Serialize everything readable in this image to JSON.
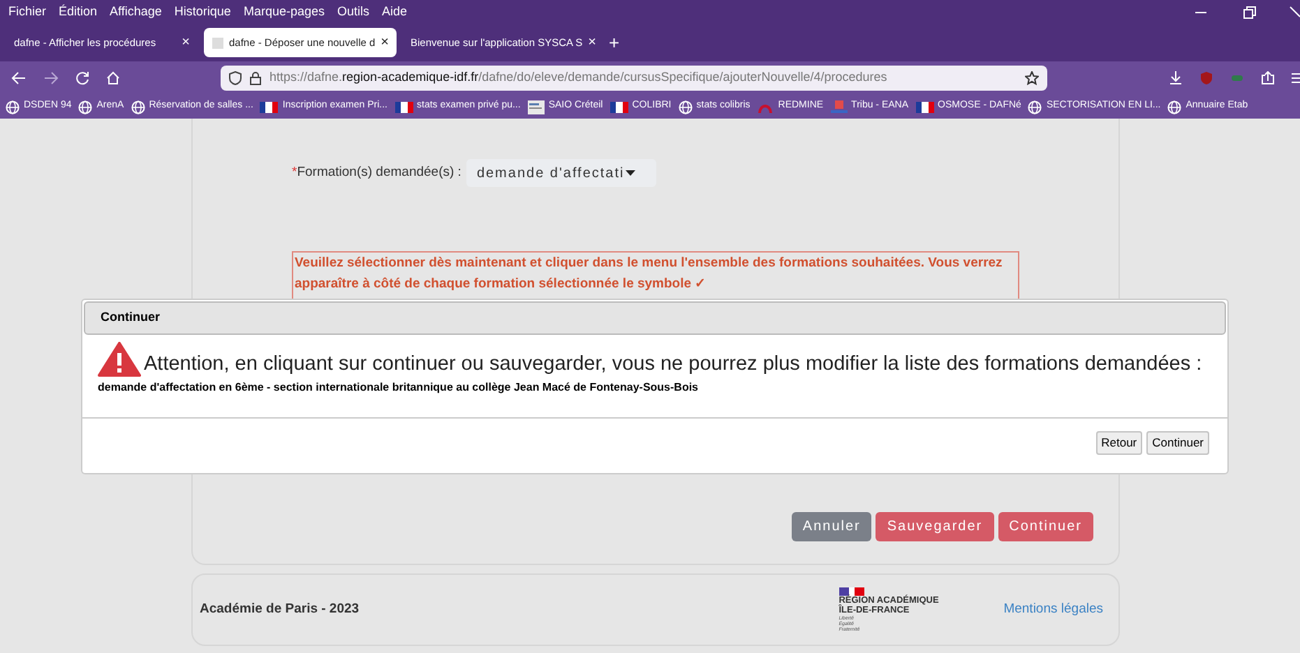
{
  "menu_bar": [
    "Fichier",
    "Édition",
    "Affichage",
    "Historique",
    "Marque-pages",
    "Outils",
    "Aide"
  ],
  "tabs": [
    {
      "label": "dafne - Afficher les procédures",
      "close": "×",
      "selected": false
    },
    {
      "label": "dafne - Déposer une nouvelle d",
      "close": "×",
      "selected": true
    },
    {
      "label": "Bienvenue sur l'application SYSCA S",
      "close": "×",
      "selected": false
    }
  ],
  "new_tab": "+",
  "address_bar": {
    "url_prefix": "https://dafne.",
    "url_domain": "region-academique-idf.fr",
    "url_path": "/dafne/do/eleve/demande/cursusSpecifique/ajouterNouvelle/4/procedures"
  },
  "bookmarks": [
    {
      "label": "DSDEN 94",
      "kind": "globe"
    },
    {
      "label": "ArenA",
      "kind": "globe"
    },
    {
      "label": "Réservation de salles ...",
      "kind": "globe"
    },
    {
      "label": "Inscription examen Pri...",
      "kind": "flag"
    },
    {
      "label": "stats examen privé pu...",
      "kind": "flag"
    },
    {
      "label": "SAIO Créteil",
      "kind": "doc"
    },
    {
      "label": "COLIBRI",
      "kind": "flag"
    },
    {
      "label": "stats colibris",
      "kind": "globe"
    },
    {
      "label": "REDMINE",
      "kind": "arch"
    },
    {
      "label": "Tribu - EANA",
      "kind": "tribu"
    },
    {
      "label": "OSMOSE - DAFNé",
      "kind": "flag"
    },
    {
      "label": "SECTORISATION EN LI...",
      "kind": "globe"
    },
    {
      "label": "Annuaire Etab",
      "kind": "globe"
    }
  ],
  "form": {
    "required_mark": "*",
    "label": "Formation(s) demandée(s) :",
    "select_value": "demande d'affectati",
    "notice": "Veuillez sélectionner dès maintenant et cliquer dans le menu l'ensemble des formations souhaitées. Vous verrez apparaître à côté de chaque formation sélectionnée le symbole ✓",
    "buttons": [
      {
        "label": "Annuler",
        "kind": "secondary"
      },
      {
        "label": "Sauvegarder",
        "kind": "danger"
      },
      {
        "label": "Continuer",
        "kind": "danger"
      }
    ]
  },
  "dialog": {
    "title": "Continuer",
    "warning": "Attention, en cliquant sur continuer ou sauvegarder, vous ne pourrez plus modifier la liste des formations demandées :",
    "detail": "demande d'affectation en 6ème - section internationale britannique au collège Jean Macé de Fontenay-Sous-Bois",
    "buttons": [
      "Retour",
      "Continuer"
    ]
  },
  "footer": {
    "text": "Académie de Paris - 2023",
    "logo_lines": [
      "RÉGION ACADÉMIQUE",
      "ÎLE-DE-FRANCE"
    ],
    "motto": [
      "Liberté",
      "Égalité",
      "Fraternité"
    ],
    "link": "Mentions légales"
  }
}
